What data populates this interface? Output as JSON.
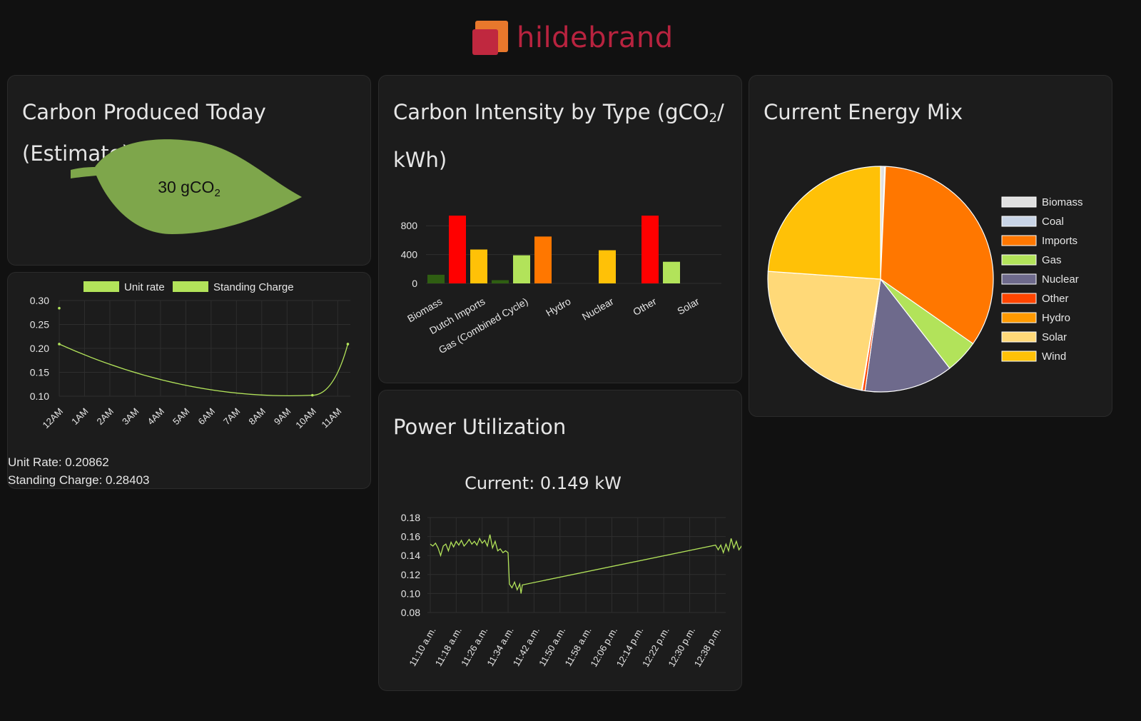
{
  "logo": {
    "text": "hildebrand"
  },
  "carbon_today": {
    "title": "Carbon Produced Today (Estimate)",
    "value_main": "30 gCO",
    "value_sub": "2",
    "leaf_color": "#7ea64b"
  },
  "tariff": {
    "legend": [
      {
        "label": "Unit rate",
        "color": "#b2e35a"
      },
      {
        "label": "Standing Charge",
        "color": "#b2e35a"
      }
    ],
    "unit_rate_text": "Unit Rate: 0.20862",
    "standing_charge_text": "Standing Charge: 0.28403"
  },
  "intensity": {
    "title_main": "Carbon Intensity by Type (gCO",
    "title_sub": "2",
    "title_end": "/",
    "title_line2": "kWh)"
  },
  "energy_mix": {
    "title": "Current Energy Mix"
  },
  "power": {
    "title": "Power Utilization",
    "current": "Current: 0.149 kW"
  },
  "chart_data": [
    {
      "id": "tariff",
      "type": "line",
      "x": [
        "12AM",
        "1AM",
        "2AM",
        "3AM",
        "4AM",
        "5AM",
        "6AM",
        "7AM",
        "8AM",
        "9AM",
        "10AM",
        "11AM"
      ],
      "series": [
        {
          "name": "Unit rate",
          "color": "#b2e35a",
          "points": [
            [
              0,
              0.209
            ],
            [
              10,
              0.102
            ],
            [
              11.4,
              0.209
            ]
          ]
        },
        {
          "name": "Standing Charge",
          "color": "#b2e35a",
          "points": [
            [
              0,
              0.284
            ]
          ]
        }
      ],
      "y_ticks": [
        "0.30",
        "0.25",
        "0.20",
        "0.15",
        "0.10"
      ],
      "ylim": [
        0.1,
        0.3
      ],
      "grid": true,
      "legend": "top"
    },
    {
      "id": "intensity",
      "type": "bar",
      "categories": [
        "Biomass",
        "Dutch Imports",
        "Gas (Combined Cycle)",
        "Hydro",
        "Nuclear",
        "Other",
        "Solar"
      ],
      "bars": [
        {
          "slot": 0,
          "value": 120,
          "color": "#2f5e12"
        },
        {
          "slot": 0.5,
          "value": 940,
          "color": "#ff0000"
        },
        {
          "slot": 1,
          "value": 470,
          "color": "#ffc107"
        },
        {
          "slot": 1.5,
          "value": 45,
          "color": "#2f5e12"
        },
        {
          "slot": 2,
          "value": 390,
          "color": "#b2e35a"
        },
        {
          "slot": 2.5,
          "value": 650,
          "color": "#ff7700"
        },
        {
          "slot": 4,
          "value": 460,
          "color": "#ffc107"
        },
        {
          "slot": 5,
          "value": 940,
          "color": "#ff0000"
        },
        {
          "slot": 5.5,
          "value": 300,
          "color": "#b2e35a"
        }
      ],
      "y_ticks": [
        "800",
        "400",
        "0"
      ],
      "ylim": [
        0,
        1000
      ],
      "grid": true
    },
    {
      "id": "energy_mix",
      "type": "pie",
      "slices": [
        {
          "label": "Biomass",
          "value": 0.6,
          "color": "#e0e0e0"
        },
        {
          "label": "Coal",
          "value": 0.1,
          "color": "#c8d4e6"
        },
        {
          "label": "Imports",
          "value": 34.0,
          "color": "#ff7700"
        },
        {
          "label": "Gas",
          "value": 4.8,
          "color": "#b2e35a"
        },
        {
          "label": "Nuclear",
          "value": 12.7,
          "color": "#6e6a8c"
        },
        {
          "label": "Other",
          "value": 0.4,
          "color": "#ff4500"
        },
        {
          "label": "Hydro",
          "value": 0.1,
          "color": "#ff9900"
        },
        {
          "label": "Solar",
          "value": 23.4,
          "color": "#ffd978"
        },
        {
          "label": "Wind",
          "value": 23.9,
          "color": "#ffc107"
        }
      ],
      "legend": "right"
    },
    {
      "id": "power",
      "type": "line",
      "x": [
        "11:10 a.m.",
        "11:18 a.m.",
        "11:26 a.m.",
        "11:34 a.m.",
        "11:42 a.m.",
        "11:50 a.m.",
        "11:58 a.m.",
        "12:06 p.m.",
        "12:14 p.m.",
        "12:22 p.m.",
        "12:30 p.m.",
        "12:38 p.m."
      ],
      "y_ticks": [
        "0.18",
        "0.16",
        "0.14",
        "0.12",
        "0.10",
        "0.08"
      ],
      "ylim": [
        0.08,
        0.18
      ],
      "series": [
        {
          "name": "",
          "color": "#b2e35a",
          "points": [
            [
              0.0,
              0.152
            ],
            [
              0.1,
              0.15
            ],
            [
              0.2,
              0.153
            ],
            [
              0.3,
              0.148
            ],
            [
              0.4,
              0.14
            ],
            [
              0.5,
              0.15
            ],
            [
              0.6,
              0.152
            ],
            [
              0.7,
              0.145
            ],
            [
              0.8,
              0.154
            ],
            [
              0.9,
              0.149
            ],
            [
              1.0,
              0.155
            ],
            [
              1.1,
              0.151
            ],
            [
              1.2,
              0.156
            ],
            [
              1.3,
              0.15
            ],
            [
              1.4,
              0.153
            ],
            [
              1.5,
              0.157
            ],
            [
              1.6,
              0.152
            ],
            [
              1.7,
              0.155
            ],
            [
              1.8,
              0.151
            ],
            [
              1.9,
              0.158
            ],
            [
              2.0,
              0.153
            ],
            [
              2.1,
              0.156
            ],
            [
              2.2,
              0.15
            ],
            [
              2.3,
              0.162
            ],
            [
              2.4,
              0.148
            ],
            [
              2.5,
              0.155
            ],
            [
              2.6,
              0.145
            ],
            [
              2.7,
              0.147
            ],
            [
              2.8,
              0.143
            ],
            [
              2.9,
              0.145
            ],
            [
              3.0,
              0.143
            ],
            [
              3.05,
              0.11
            ],
            [
              3.15,
              0.106
            ],
            [
              3.25,
              0.112
            ],
            [
              3.35,
              0.104
            ],
            [
              3.45,
              0.11
            ],
            [
              3.5,
              0.1
            ],
            [
              3.55,
              0.109
            ],
            [
              11.0,
              0.151
            ],
            [
              11.1,
              0.146
            ],
            [
              11.2,
              0.151
            ],
            [
              11.3,
              0.143
            ],
            [
              11.4,
              0.152
            ],
            [
              11.5,
              0.145
            ],
            [
              11.6,
              0.158
            ],
            [
              11.7,
              0.148
            ],
            [
              11.8,
              0.155
            ],
            [
              11.9,
              0.146
            ],
            [
              12.0,
              0.15
            ],
            [
              12.1,
              0.148
            ],
            [
              12.2,
              0.15
            ]
          ]
        }
      ],
      "grid": true
    }
  ]
}
